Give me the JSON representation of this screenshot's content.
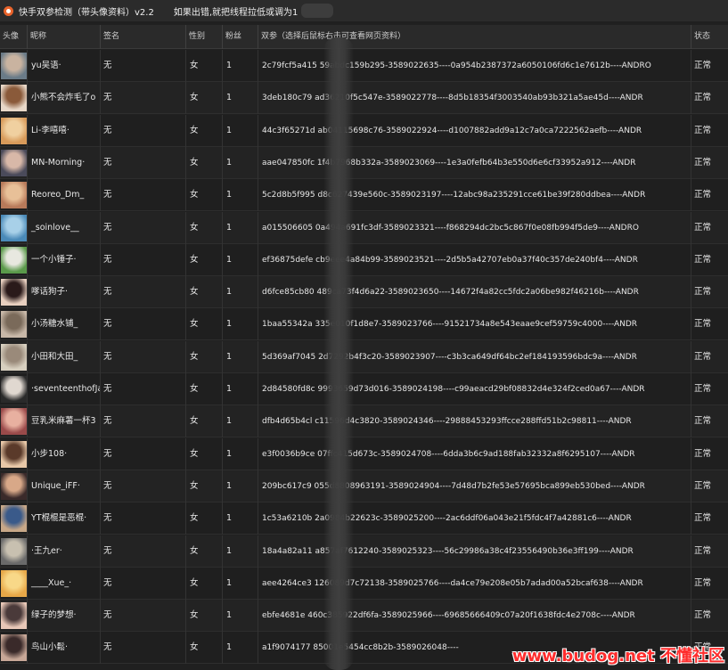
{
  "window": {
    "title": "快手双参检测（带头像资料）v2.2",
    "note": "如果出错,就把线程拉低或调为1"
  },
  "columns": {
    "avatar": "头像",
    "nickname": "昵称",
    "signature": "签名",
    "gender": "性别",
    "fans": "粉丝",
    "params": "双参（选择后鼠标右击可查看网页资料）",
    "status": "状态"
  },
  "rows": [
    {
      "nickname": "yu吴语·",
      "signature": "无",
      "gender": "女",
      "fans": "1",
      "params": "2c79fcf5a415            59abdc159b295-3589022635----0a954b2387372a6050106fd6c1e7612b----ANDRO",
      "status": "正常",
      "avatar_colors": [
        "#6a7b88",
        "#c9b3a0"
      ]
    },
    {
      "nickname": "小熊不会炸毛了o",
      "signature": "无",
      "gender": "女",
      "fans": "1",
      "params": "3deb180c79            ad36210f5c547e-3589022778----8d5b18354f3003540ab93b321a5ae45d----ANDR",
      "status": "正常",
      "avatar_colors": [
        "#e8d8c8",
        "#8a5a3a"
      ]
    },
    {
      "nickname": "Li-李嘻嘻·",
      "signature": "无",
      "gender": "女",
      "fans": "1",
      "params": "44c3f65271d            ab04115698c76-3589022924----d1007882add9a12c7a0ca7222562aefb----ANDR",
      "status": "正常",
      "avatar_colors": [
        "#d89a5a",
        "#f0d0a0"
      ]
    },
    {
      "nickname": "MN-Morning·",
      "signature": "无",
      "gender": "女",
      "fans": "1",
      "params": "aae047850fc            1f4b7968b332a-3589023069----1e3a0fefb64b3e550d6e6cf33952a912----ANDR",
      "status": "正常",
      "avatar_colors": [
        "#4a4a5a",
        "#d8b8a8"
      ]
    },
    {
      "nickname": "Reoreo_Dm_",
      "signature": "无",
      "gender": "女",
      "fans": "1",
      "params": "5c2d8b5f995            d8c627439e560c-3589023197----12abc98a235291cce61be39f280ddbea----ANDR",
      "status": "正常",
      "avatar_colors": [
        "#b87a5a",
        "#e8c098"
      ]
    },
    {
      "nickname": "_soinlove__",
      "signature": "无",
      "gender": "女",
      "fans": "1",
      "params": "a015506605            0a494a691fc3df-3589023321----f868294dc2bc5c867f0e08fb994f5de9----ANDRO",
      "status": "正常",
      "avatar_colors": [
        "#4a8ab8",
        "#a8d0e8"
      ]
    },
    {
      "nickname": "一个小锤子·",
      "signature": "无",
      "gender": "女",
      "fans": "1",
      "params": "ef36875defe            cb9eee4a84b99-3589023521----2d5b5a42707eb0a37f40c357de240bf4----ANDR",
      "status": "正常",
      "avatar_colors": [
        "#5a9a4a",
        "#e8e8e0"
      ]
    },
    {
      "nickname": "嗲话狗子·",
      "signature": "无",
      "gender": "女",
      "fans": "1",
      "params": "d6fce85cb80            489ca73f4d6a22-3589023650----14672f4a82cc5fdc2a06be982f46216b----ANDR",
      "status": "正常",
      "avatar_colors": [
        "#e8d0c0",
        "#2a1a1a"
      ]
    },
    {
      "nickname": "小汤糖水铺_",
      "signature": "无",
      "gender": "女",
      "fans": "1",
      "params": "1baa55342a            335e010f1d8e7-3589023766----91521734a8e543eaae9cef59759c4000----ANDR",
      "status": "正常",
      "avatar_colors": [
        "#c8b8a8",
        "#7a6a5a"
      ]
    },
    {
      "nickname": "小田和大田_",
      "signature": "无",
      "gender": "女",
      "fans": "1",
      "params": "5d369af7045            2d7292b4f3c20-3589023907----c3b3ca649df64bc2ef184193596bdc9a----ANDR",
      "status": "正常",
      "avatar_colors": [
        "#d8d0c0",
        "#9a8a7a"
      ]
    },
    {
      "nickname": "·seventeenthofJa",
      "signature": "无",
      "gender": "女",
      "fans": "1",
      "params": "2d84580fd8c            9993659d73d016-3589024198----c99aeacd29bf08832d4e324f2ced0a67----ANDR",
      "status": "正常",
      "avatar_colors": [
        "#2a2a2a",
        "#e0d8d0"
      ]
    },
    {
      "nickname": "豆乳米麻薯一杯3",
      "signature": "无",
      "gender": "女",
      "fans": "1",
      "params": "dfb4d65b4cl            c11596d4c3820-3589024346----29888453293ffcce288ffd51b2c98811----ANDR",
      "status": "正常",
      "avatar_colors": [
        "#9a4a4a",
        "#e8b0a0"
      ]
    },
    {
      "nickname": "小步108·",
      "signature": "无",
      "gender": "女",
      "fans": "1",
      "params": "e3f0036b9ce            07ffc415d673c-3589024708----6dda3b6c9ad188fab32332a8f6295107----ANDR",
      "status": "正常",
      "avatar_colors": [
        "#e8c8a8",
        "#5a3a2a"
      ]
    },
    {
      "nickname": "Unique_iFF·",
      "signature": "无",
      "gender": "女",
      "fans": "1",
      "params": "209bc617c9            055d8808963191-3589024904----7d48d7b2fe53e57695bca899eb530bed----ANDR",
      "status": "正常",
      "avatar_colors": [
        "#3a2a2a",
        "#d8a888"
      ]
    },
    {
      "nickname": "YT棍棍是恶棍·",
      "signature": "无",
      "gender": "女",
      "fans": "1",
      "params": "1c53a6210b            2a0984b22623c-3589025200----2ac6ddf06a043e21f5fdc4f7a42881c6----ANDR",
      "status": "正常",
      "avatar_colors": [
        "#c8a888",
        "#3a5a8a"
      ]
    },
    {
      "nickname": "·王九er·",
      "signature": "无",
      "gender": "女",
      "fans": "1",
      "params": "18a4a82a11            a857af7612240-3589025323----56c29986a38c4f23556490b36e3ff199----ANDR",
      "status": "正常",
      "avatar_colors": [
        "#6a6a6a",
        "#c8c0b0"
      ]
    },
    {
      "nickname": "____Xue_·",
      "signature": "无",
      "gender": "女",
      "fans": "1",
      "params": "aee4264ce3            126089d7c72138-3589025766----da4ce79e208e05b7adad00a52bcaf638----ANDR",
      "status": "正常",
      "avatar_colors": [
        "#e8a848",
        "#f8d888"
      ]
    },
    {
      "nickname": "绿子的梦想·",
      "signature": "无",
      "gender": "女",
      "fans": "1",
      "params": "ebfe4681e            460c385922df6fa-3589025966----69685666409c07a20f1638fdc4e2708c----ANDR",
      "status": "正常",
      "avatar_colors": [
        "#e8c8b8",
        "#4a3a3a"
      ]
    },
    {
      "nickname": "鸟山小鬆·",
      "signature": "无",
      "gender": "女",
      "fans": "1",
      "params": "a1f9074177            85001e5454cc8b2b-3589026048----",
      "status": "正常",
      "avatar_colors": [
        "#c8a898",
        "#3a2a2a"
      ]
    }
  ],
  "watermark": "www.budog.net 不懂社区"
}
